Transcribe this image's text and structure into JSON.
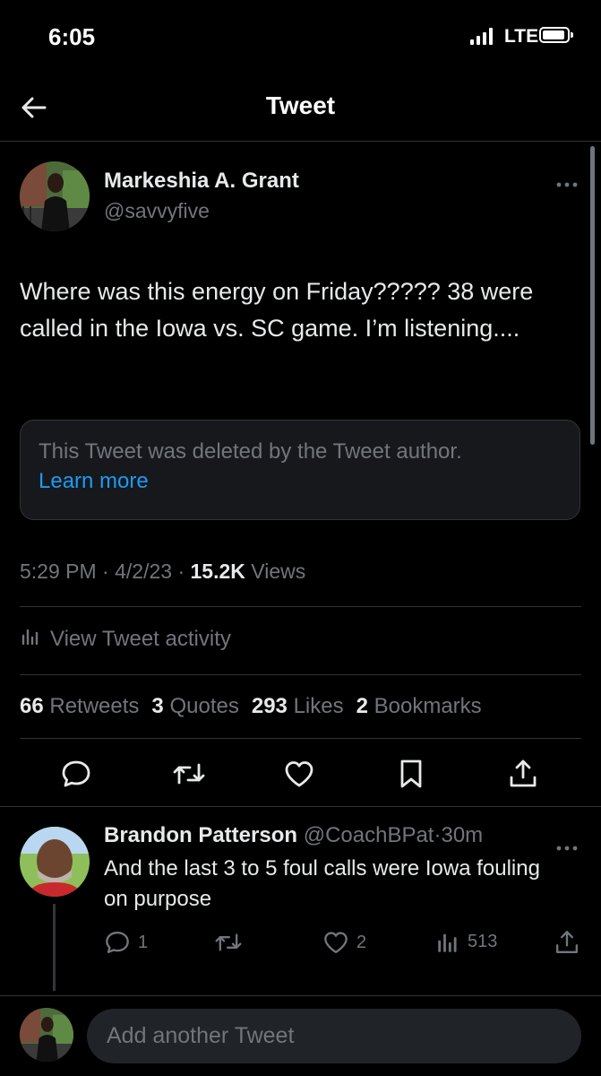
{
  "status_bar": {
    "time": "6:05",
    "network": "LTE",
    "battery_level": 0.85,
    "signal_bars": 4
  },
  "nav": {
    "title": "Tweet",
    "back_icon": "arrow-left-icon"
  },
  "tweet": {
    "author_name": "Markeshia A. Grant",
    "author_handle": "@savvyfive",
    "more_icon": "more-icon",
    "text": "Where was this energy on Friday????? 38 were called in the Iowa vs. SC game. I’m listening....",
    "quoted_notice": "This Tweet was deleted by the Tweet author.",
    "learn_more": "Learn more",
    "time": "5:29 PM",
    "date": "4/2/23",
    "views_count": "15.2K",
    "views_label": "Views",
    "separator": "·",
    "activity_label": "View Tweet activity",
    "stats": {
      "retweets_count": "66",
      "retweets_label": "Retweets",
      "quotes_count": "3",
      "quotes_label": "Quotes",
      "likes_count": "293",
      "likes_label": "Likes",
      "bookmarks_count": "2",
      "bookmarks_label": "Bookmarks"
    },
    "actions": [
      "reply-icon",
      "retweet-icon",
      "like-icon",
      "bookmark-icon",
      "share-icon"
    ]
  },
  "reply": {
    "author_name": "Brandon Patterson",
    "author_handle": "@CoachBPat",
    "separator": "·",
    "time_ago": "30m",
    "text": "And the last 3 to 5 foul calls were Iowa fouling on purpose",
    "reply_count": "1",
    "like_count": "2",
    "views_count": "513"
  },
  "compose": {
    "placeholder": "Add another Tweet"
  },
  "colors": {
    "background": "#000000",
    "text": "#e7e9ea",
    "muted": "#71767b",
    "accent": "#1d9bf0",
    "divider": "#2f3336"
  }
}
